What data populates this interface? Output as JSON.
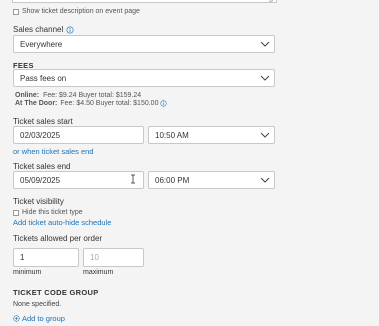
{
  "show_description": {
    "label": "Show ticket description on event page"
  },
  "sales_channel": {
    "label": "Sales channel",
    "value": "Everywhere"
  },
  "fees": {
    "heading": "FEES",
    "value": "Pass fees on",
    "online_label": "Online:",
    "online_text": "Fee: $9.24 Buyer total: $159.24",
    "door_label": "At The Door:",
    "door_text": "Fee: $4.50 Buyer total: $150.00"
  },
  "sales_start": {
    "label": "Ticket sales start",
    "date": "02/03/2025",
    "time": "10:50 AM",
    "link": "or when ticket sales end"
  },
  "sales_end": {
    "label": "Ticket sales end",
    "date": "05/09/2025",
    "time": "06:00 PM"
  },
  "visibility": {
    "label": "Ticket visibility",
    "hide_label": "Hide this ticket type",
    "schedule_link": "Add ticket auto-hide schedule"
  },
  "allowed": {
    "label": "Tickets allowed per order",
    "min_value": "1",
    "max_placeholder": "10",
    "min_label": "minimum",
    "max_label": "maximum"
  },
  "code_group": {
    "heading": "TICKET CODE GROUP",
    "none_text": "None specified.",
    "add_link": "Add to group"
  },
  "colors": {
    "link": "#1a73b8",
    "background": "#f4f4f4"
  }
}
